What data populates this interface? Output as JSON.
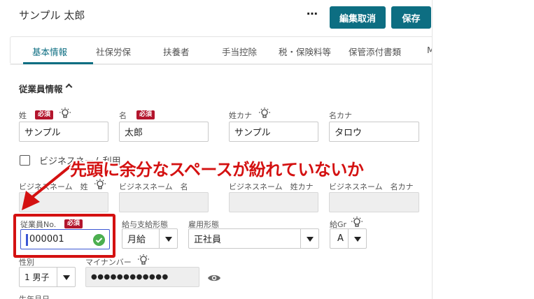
{
  "header": {
    "employee_name": "サンプル 太郎",
    "more_icon": "⋯",
    "cancel_edit_label": "編集取消",
    "save_label": "保存"
  },
  "tabs": [
    {
      "label": "基本情報",
      "active": true
    },
    {
      "label": "社保労保"
    },
    {
      "label": "扶養者"
    },
    {
      "label": "手当控除"
    },
    {
      "label": "税・保険料等"
    },
    {
      "label": "保管添付書類"
    },
    {
      "label": "M"
    }
  ],
  "section": {
    "title": "従業員情報"
  },
  "required_badge": "必須",
  "fields": {
    "last_name": {
      "label": "姓",
      "value": "サンプル"
    },
    "first_name": {
      "label": "名",
      "value": "太郎"
    },
    "last_name_kana": {
      "label": "姓カナ",
      "value": "サンプル"
    },
    "first_name_kana": {
      "label": "名カナ",
      "value": "タロウ"
    },
    "business_name_checkbox": {
      "label": "ビジネスネーム利用",
      "checked": false
    },
    "business_last": {
      "label": "ビジネスネーム　姓",
      "value": ""
    },
    "business_first": {
      "label": "ビジネスネーム　名",
      "value": ""
    },
    "business_last_kana": {
      "label": "ビジネスネーム　姓カナ",
      "value": ""
    },
    "business_first_kana": {
      "label": "ビジネスネーム　名カナ",
      "value": ""
    },
    "employee_no": {
      "label": "従業員No.",
      "value": "000001"
    },
    "pay_form": {
      "label": "給与支給形態",
      "value": "月給"
    },
    "employment_type": {
      "label": "雇用形態",
      "value": "正社員"
    },
    "salary_grade": {
      "label": "給Gr",
      "value": "A"
    },
    "gender": {
      "label": "性別",
      "value": "1 男子"
    },
    "my_number": {
      "label": "マイナンバー",
      "value": "●●●●●●●●●●●●"
    },
    "birth_date": {
      "label": "生年月日"
    }
  },
  "annotation": {
    "callout_text": "先頭に余分なスペースが紛れていないか",
    "color": "#d41111"
  },
  "colors": {
    "accent": "#0d6e82",
    "required": "#b3152d",
    "success": "#4caf50"
  }
}
